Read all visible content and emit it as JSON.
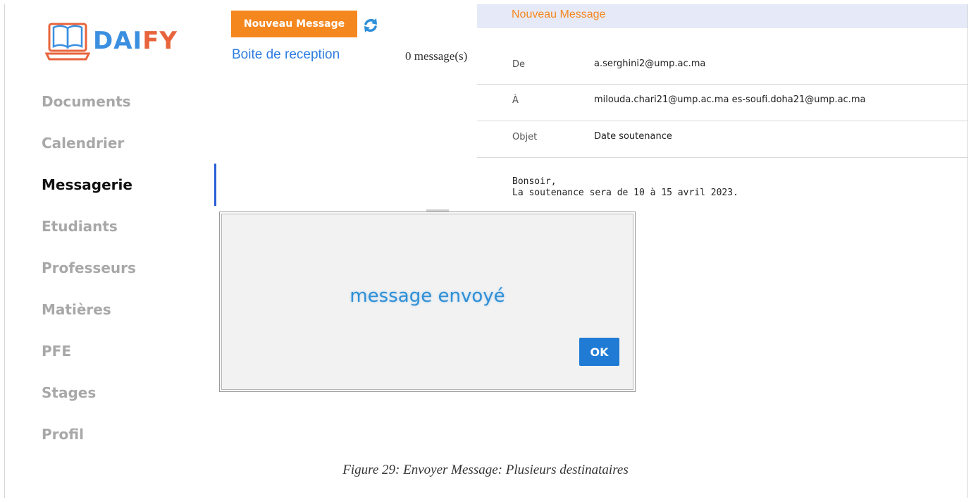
{
  "sidebar": {
    "logo": {
      "part1": "DAI",
      "part2": "FY"
    },
    "items": [
      {
        "label": "Documents",
        "active": false
      },
      {
        "label": "Calendrier",
        "active": false
      },
      {
        "label": "Messagerie",
        "active": true
      },
      {
        "label": "Etudiants",
        "active": false
      },
      {
        "label": "Professeurs",
        "active": false
      },
      {
        "label": "Matières",
        "active": false
      },
      {
        "label": "PFE",
        "active": false
      },
      {
        "label": "Stages",
        "active": false
      },
      {
        "label": "Profil",
        "active": false
      }
    ]
  },
  "mail_list": {
    "new_button_label": "Nouveau Message",
    "inbox_label": "Boite de reception",
    "message_count": "0 message(s)",
    "refresh_icon": "refresh-icon"
  },
  "compose": {
    "header_title": "Nouveau Message",
    "from_label": "De",
    "from_value": "a.serghini2@ump.ac.ma",
    "to_label": "À",
    "to_value": "milouda.chari21@ump.ac.ma es-soufi.doha21@ump.ac.ma",
    "subject_label": "Objet",
    "subject_value": "Date soutenance",
    "body_line1": "Bonsoir,",
    "body_line2": "La soutenance sera de 10 à 15 avril 2023."
  },
  "dialog": {
    "message": "message envoyé",
    "ok_label": "OK"
  },
  "caption": "Figure 29: Envoyer Message: Plusieurs destinataires",
  "colors": {
    "accent_orange": "#f5871f",
    "link_blue": "#2f7de1",
    "active_bar": "#2b5fd9",
    "ok_blue": "#1f7bd4"
  }
}
